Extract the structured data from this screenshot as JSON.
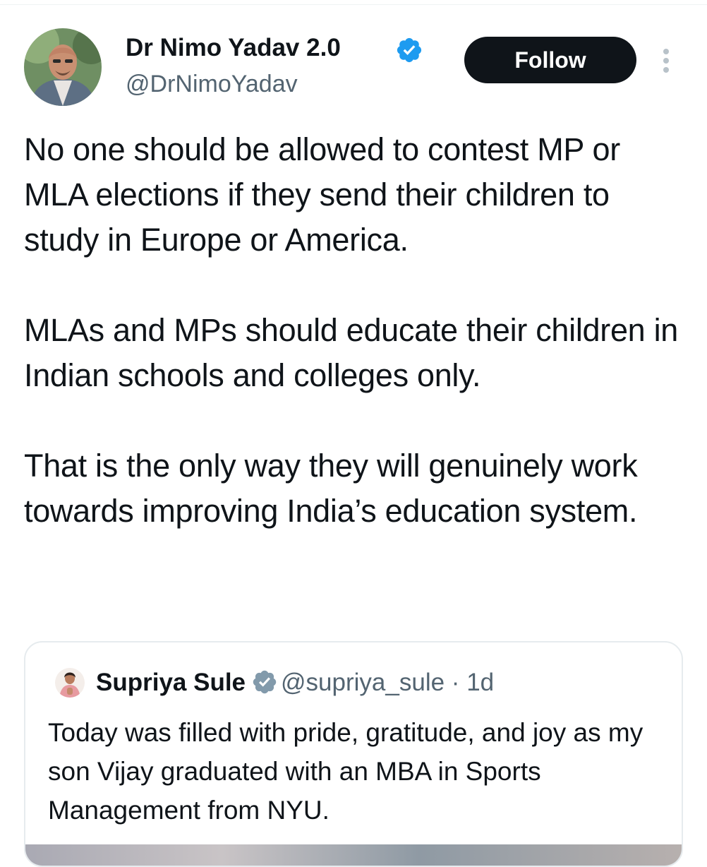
{
  "tweet": {
    "author": {
      "name": "Dr Nimo Yadav 2.0",
      "handle": "@DrNimoYadav",
      "verified": true,
      "avatar_icon": "profile-photo"
    },
    "follow_label": "Follow",
    "more_icon": "more-vertical-icon",
    "paragraphs": [
      "No one should be allowed to contest MP or MLA elections if they send their children to study in Europe or America.",
      "MLAs and MPs should educate their children in Indian schools and colleges only.",
      "That is the only way they will genuinely work towards improving India’s education system."
    ]
  },
  "quote": {
    "author": {
      "name": "Supriya Sule",
      "handle": "@supriya_sule",
      "verified": true,
      "avatar_icon": "profile-photo"
    },
    "separator": "·",
    "time": "1d",
    "text": "Today was filled with pride, gratitude, and joy as my son Vijay graduated with an MBA in Sports Management from NYU."
  },
  "colors": {
    "text_primary": "#0f1419",
    "text_secondary": "#536471",
    "verified_blue": "#1d9bf0",
    "verified_gray": "#829aab",
    "follow_bg": "#0f1419",
    "border": "#e6ebee"
  }
}
